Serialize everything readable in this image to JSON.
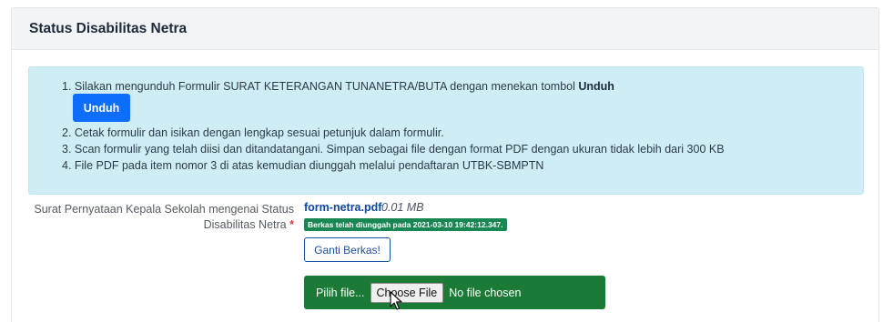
{
  "header": {
    "title": "Status Disabilitas Netra"
  },
  "instructions": {
    "step1_text": "1. Silakan mengunduh Formulir SURAT KETERANGAN TUNANETRA/BUTA dengan menekan tombol ",
    "step1_bold": "Unduh",
    "unduh_button": "Unduh",
    "step2": "2. Cetak formulir dan isikan dengan lengkap sesuai petunjuk dalam formulir.",
    "step3": "3. Scan formulir yang telah diisi dan ditandatangani. Simpan sebagai file dengan format PDF dengan ukuran tidak lebih dari 300 KB",
    "step4": "4. File PDF pada item nomor 3 di atas kemudian diunggah melalui pendaftaran UTBK-SBMPTN"
  },
  "form": {
    "label_line1": "Surat Pernyataan Kepala Sekolah mengenai Status",
    "label_line2": "Disabilitas Netra",
    "required_mark": "*",
    "file_name": "form-netra.pdf",
    "file_size": "0.01 MB",
    "uploaded_badge": "Berkas telah diunggah pada 2021-03-10 19:42:12.347.",
    "change_button": "Ganti Berkas!",
    "file_input": {
      "prefix": "Pilih file...",
      "choose_button": "Choose File",
      "status": "No file chosen"
    }
  },
  "colors": {
    "primary": "#0d6efd",
    "alert_bg": "#cfedf4",
    "success": "#198754",
    "file_input_bg": "#1a7a36",
    "required": "#dc3545"
  }
}
